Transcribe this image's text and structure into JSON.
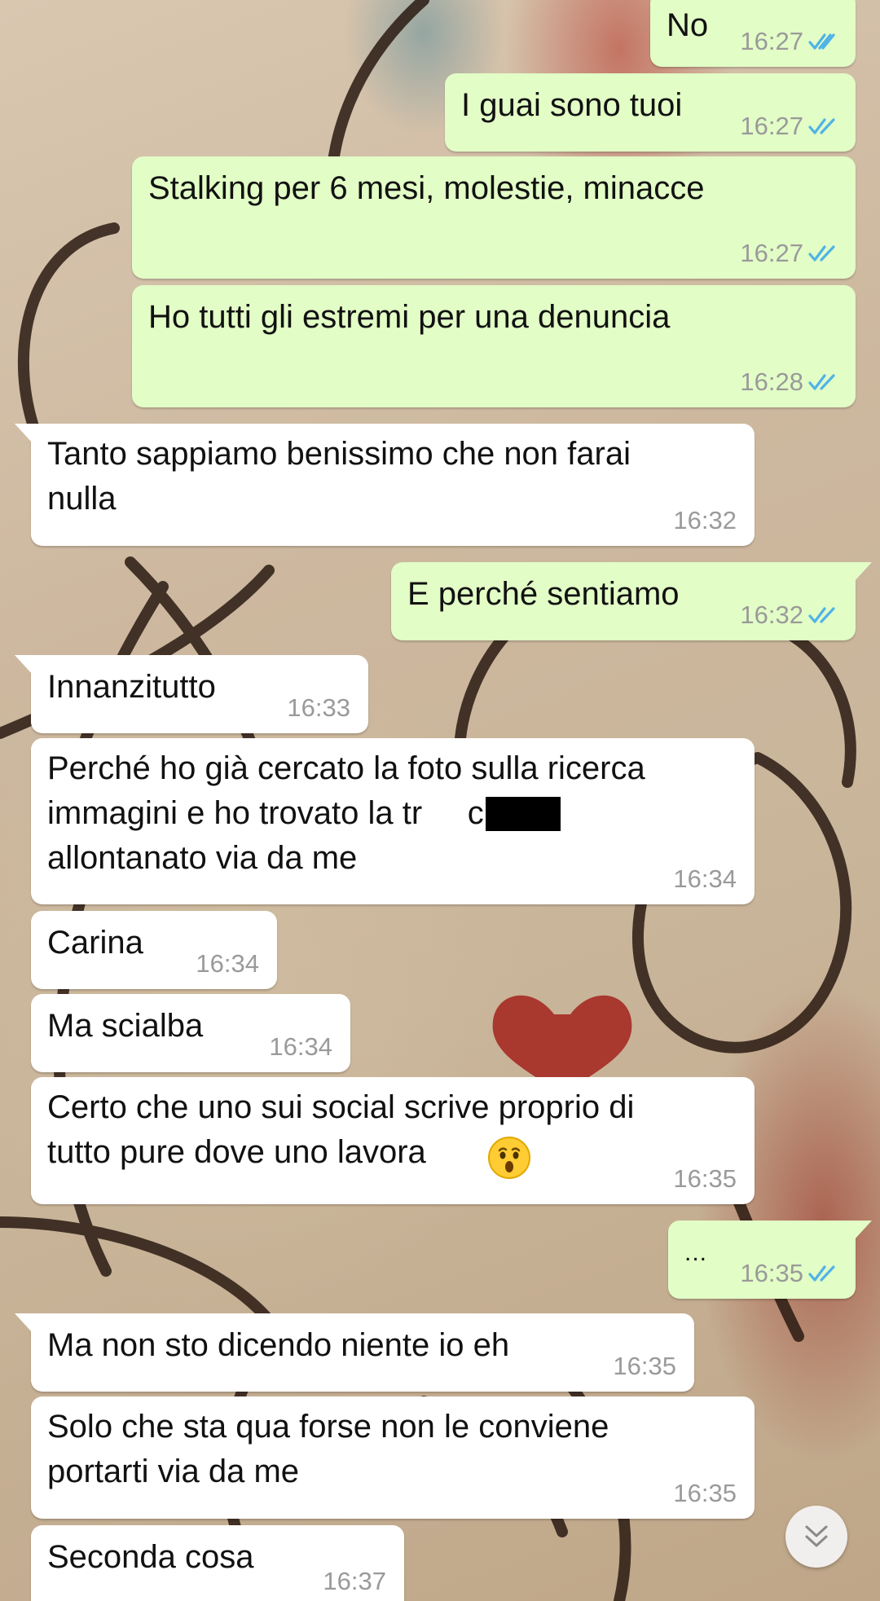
{
  "colors": {
    "incoming_bubble": "#ffffff",
    "outgoing_bubble": "#e2fdc6",
    "read_ticks": "#4fb3e8",
    "timestamp": "#9a9a9a"
  },
  "messages": [
    {
      "direction": "out",
      "text": "No",
      "time": "16:27",
      "status": "read"
    },
    {
      "direction": "out",
      "text": "I guai sono tuoi",
      "time": "16:27",
      "status": "read"
    },
    {
      "direction": "out",
      "text": "Stalking per 6 mesi, molestie, minacce",
      "time": "16:27",
      "status": "read"
    },
    {
      "direction": "out",
      "text": "Ho tutti gli estremi per una denuncia",
      "time": "16:28",
      "status": "read"
    },
    {
      "direction": "in",
      "text": "Tanto sappiamo benissimo che non farai\nnulla",
      "time": "16:32"
    },
    {
      "direction": "out",
      "text": "E perché sentiamo",
      "time": "16:32",
      "status": "read"
    },
    {
      "direction": "in",
      "text": "Innanzitutto",
      "time": "16:33"
    },
    {
      "direction": "in",
      "text": "Perché ho già cercato la foto sulla ricerca\nimmagini e ho trovato la tr     che ti\nallontanato via da me",
      "time": "16:34"
    },
    {
      "direction": "in",
      "text": "Carina",
      "time": "16:34"
    },
    {
      "direction": "in",
      "text": "Ma scialba",
      "time": "16:34"
    },
    {
      "direction": "in",
      "text": "Certo che uno sui social scrive proprio di\ntutto pure dove uno lavora",
      "time": "16:35",
      "emoji": "astonished-face"
    },
    {
      "direction": "out",
      "text": "...",
      "time": "16:35",
      "status": "read"
    },
    {
      "direction": "in",
      "text": "Ma non sto dicendo niente io eh",
      "time": "16:35"
    },
    {
      "direction": "in",
      "text": "Solo che sta qua forse non le conviene\nportarti via da me",
      "time": "16:35"
    },
    {
      "direction": "in",
      "text": "Seconda cosa",
      "time": "16:37"
    }
  ],
  "scroll_button": {
    "icon": "double-chevron-down-icon"
  }
}
